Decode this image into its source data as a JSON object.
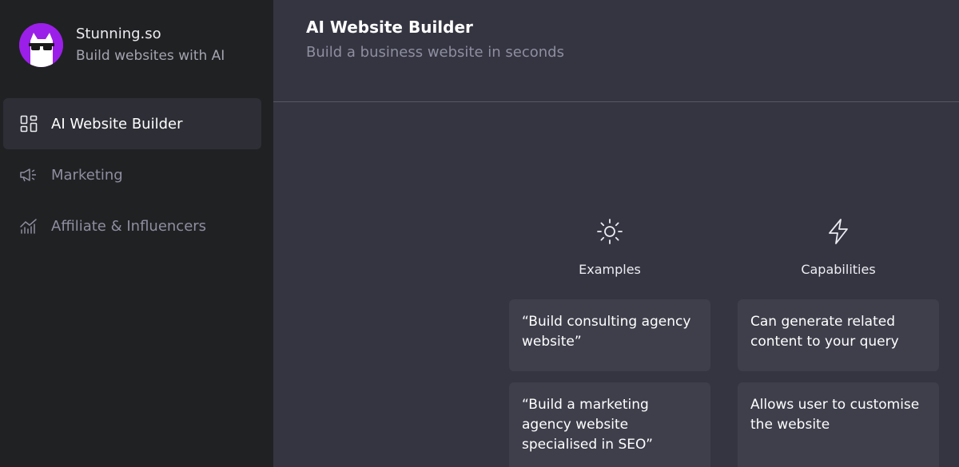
{
  "brand": {
    "name": "Stunning.so",
    "tagline": "Build websites with AI",
    "avatar_color": "#9b1fe8"
  },
  "sidebar": {
    "items": [
      {
        "label": "AI Website Builder",
        "icon": "grid-layout-icon",
        "active": true
      },
      {
        "label": "Marketing",
        "icon": "megaphone-icon",
        "active": false
      },
      {
        "label": "Affiliate & Influencers",
        "icon": "chart-trend-icon",
        "active": false
      }
    ]
  },
  "header": {
    "title": "AI Website Builder",
    "subtitle": "Build a business website in seconds"
  },
  "columns": {
    "examples": {
      "icon": "sun-icon",
      "title": "Examples",
      "cards": [
        "“Build consulting agency website”",
        "“Build a marketing agency website specialised in SEO”"
      ]
    },
    "capabilities": {
      "icon": "lightning-icon",
      "title": "Capabilities",
      "cards": [
        "Can generate related content to your query",
        "Allows user to customise the website"
      ]
    }
  },
  "colors": {
    "sidebar_bg": "#202123",
    "main_bg": "#343541",
    "card_bg": "#3e3f4b",
    "active_item_bg": "#2e2f36"
  }
}
